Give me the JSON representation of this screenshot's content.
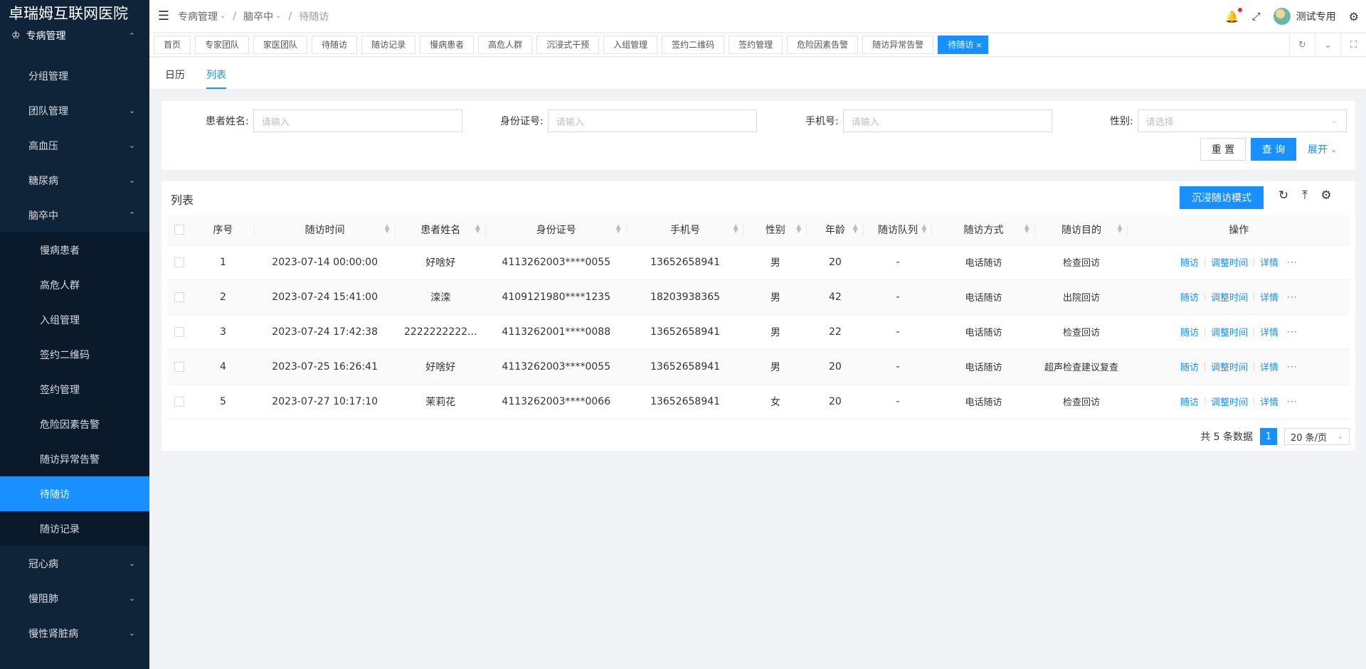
{
  "app": {
    "title": "卓瑞姆互联网医院"
  },
  "sidebar": {
    "top": {
      "label": "专病管理"
    },
    "items": [
      {
        "label": "分组管理",
        "arrow": "",
        "sub": false,
        "active": false
      },
      {
        "label": "团队管理",
        "arrow": "⌄",
        "sub": false,
        "active": false
      },
      {
        "label": "高血压",
        "arrow": "⌄",
        "sub": false,
        "active": false
      },
      {
        "label": "糖尿病",
        "arrow": "⌄",
        "sub": false,
        "active": false
      },
      {
        "label": "脑卒中",
        "arrow": "⌃",
        "sub": false,
        "active": false
      },
      {
        "label": "慢病患者",
        "arrow": "",
        "sub": true,
        "active": false
      },
      {
        "label": "高危人群",
        "arrow": "",
        "sub": true,
        "active": false
      },
      {
        "label": "入组管理",
        "arrow": "",
        "sub": true,
        "active": false
      },
      {
        "label": "签约二维码",
        "arrow": "",
        "sub": true,
        "active": false
      },
      {
        "label": "签约管理",
        "arrow": "",
        "sub": true,
        "active": false
      },
      {
        "label": "危险因素告警",
        "arrow": "",
        "sub": true,
        "active": false
      },
      {
        "label": "随访异常告警",
        "arrow": "",
        "sub": true,
        "active": false
      },
      {
        "label": "待随访",
        "arrow": "",
        "sub": true,
        "active": true
      },
      {
        "label": "随访记录",
        "arrow": "",
        "sub": true,
        "active": false
      },
      {
        "label": "冠心病",
        "arrow": "⌄",
        "sub": false,
        "active": false
      },
      {
        "label": "慢阻肺",
        "arrow": "⌄",
        "sub": false,
        "active": false
      },
      {
        "label": "慢性肾脏病",
        "arrow": "⌄",
        "sub": false,
        "active": false
      }
    ]
  },
  "header": {
    "breadcrumb": [
      "专病管理",
      "脑卒中",
      "待随访"
    ],
    "user": "测试专用"
  },
  "tabs": [
    "首页",
    "专家团队",
    "家医团队",
    "待随访",
    "随访记录",
    "慢病患者",
    "高危人群",
    "沉浸式干预",
    "入组管理",
    "签约二维码",
    "签约管理",
    "危险因素告警",
    "随访异常告警",
    "待随访"
  ],
  "subtabs": [
    "日历",
    "列表"
  ],
  "search": {
    "name_label": "患者姓名:",
    "name_placeholder": "请输入",
    "id_label": "身份证号:",
    "id_placeholder": "请输入",
    "phone_label": "手机号:",
    "phone_placeholder": "请输入",
    "gender_label": "性别:",
    "gender_placeholder": "请选择",
    "reset": "重 置",
    "query": "查 询",
    "expand": "展开"
  },
  "table": {
    "title": "列表",
    "immersive": "沉浸随访模式",
    "columns": [
      "序号",
      "随访时间",
      "患者姓名",
      "身份证号",
      "手机号",
      "性别",
      "年龄",
      "随访队列",
      "随访方式",
      "随访目的",
      "操作"
    ],
    "rows": [
      {
        "no": "1",
        "time": "2023-07-14 00:00:00",
        "name": "好啥好",
        "id": "4113262003****0055",
        "phone": "13652658941",
        "gender": "男",
        "age": "20",
        "cohort": "-",
        "method": "电话随访",
        "purpose": "检查回访"
      },
      {
        "no": "2",
        "time": "2023-07-24 15:41:00",
        "name": "滦滦",
        "id": "4109121980****1235",
        "phone": "18203938365",
        "gender": "男",
        "age": "42",
        "cohort": "-",
        "method": "电话随访",
        "purpose": "出院回访"
      },
      {
        "no": "3",
        "time": "2023-07-24 17:42:38",
        "name": "2222222222...",
        "id": "4113262001****0088",
        "phone": "13652658941",
        "gender": "男",
        "age": "22",
        "cohort": "-",
        "method": "电话随访",
        "purpose": "检查回访"
      },
      {
        "no": "4",
        "time": "2023-07-25 16:26:41",
        "name": "好啥好",
        "id": "4113262003****0055",
        "phone": "13652658941",
        "gender": "男",
        "age": "20",
        "cohort": "-",
        "method": "电话随访",
        "purpose": "超声检查建议复查"
      },
      {
        "no": "5",
        "time": "2023-07-27 10:17:10",
        "name": "茉莉花",
        "id": "4113262003****0066",
        "phone": "13652658941",
        "gender": "女",
        "age": "20",
        "cohort": "-",
        "method": "电话随访",
        "purpose": "检查回访"
      }
    ],
    "ops": {
      "visit": "随访",
      "adjust": "调整时间",
      "detail": "详情",
      "more": "···"
    }
  },
  "pager": {
    "total": "共 5 条数据",
    "page": "1",
    "size": "20 条/页"
  },
  "colors": {
    "primary": "#1890ff",
    "sidebar": "#0f2438"
  }
}
